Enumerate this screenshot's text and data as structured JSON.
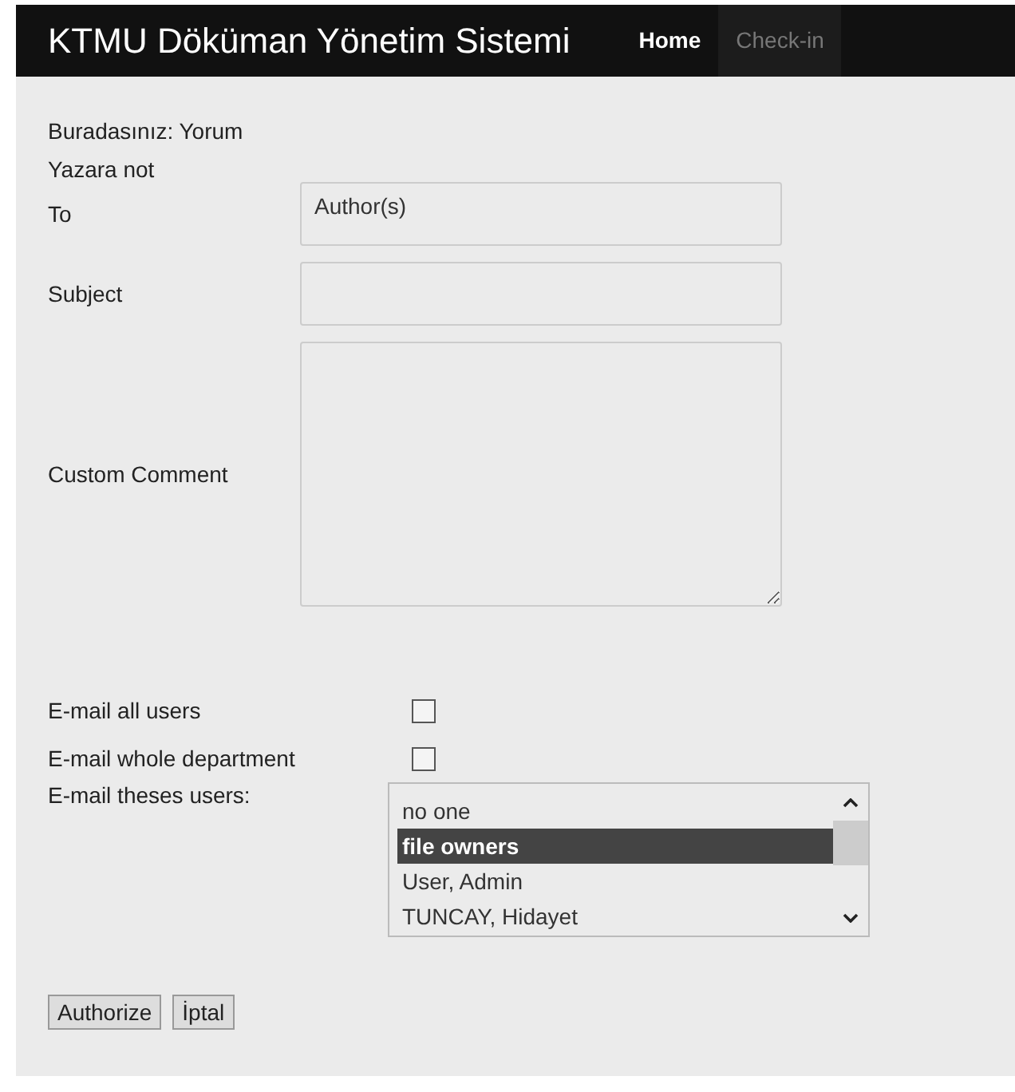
{
  "header": {
    "title": "KTMU Döküman Yönetim Sistemi",
    "nav": [
      {
        "label": "Home",
        "selected": true
      },
      {
        "label": "Check-in",
        "selected": false
      }
    ]
  },
  "breadcrumb": "Buradasınız: Yorum",
  "heading": "Yazara not",
  "fields": [
    {
      "label": "To",
      "kind": "input",
      "value": "Author(s)"
    },
    {
      "label": "Subject",
      "kind": "input"
    },
    {
      "label": "Custom Comment",
      "kind": "textarea"
    }
  ],
  "options": [
    {
      "label": "E-mail all users",
      "checked": false
    },
    {
      "label": "E-mail whole department",
      "checked": false
    }
  ],
  "users": {
    "label": "E-mail theses users:",
    "items": [
      {
        "label": "no one",
        "selected": false
      },
      {
        "label": "file owners",
        "selected": true
      },
      {
        "label": "User, Admin",
        "selected": false
      },
      {
        "label": "TUNCAY, Hidayet",
        "selected": false
      }
    ]
  },
  "buttons": [
    "Authorize",
    "İptal"
  ]
}
